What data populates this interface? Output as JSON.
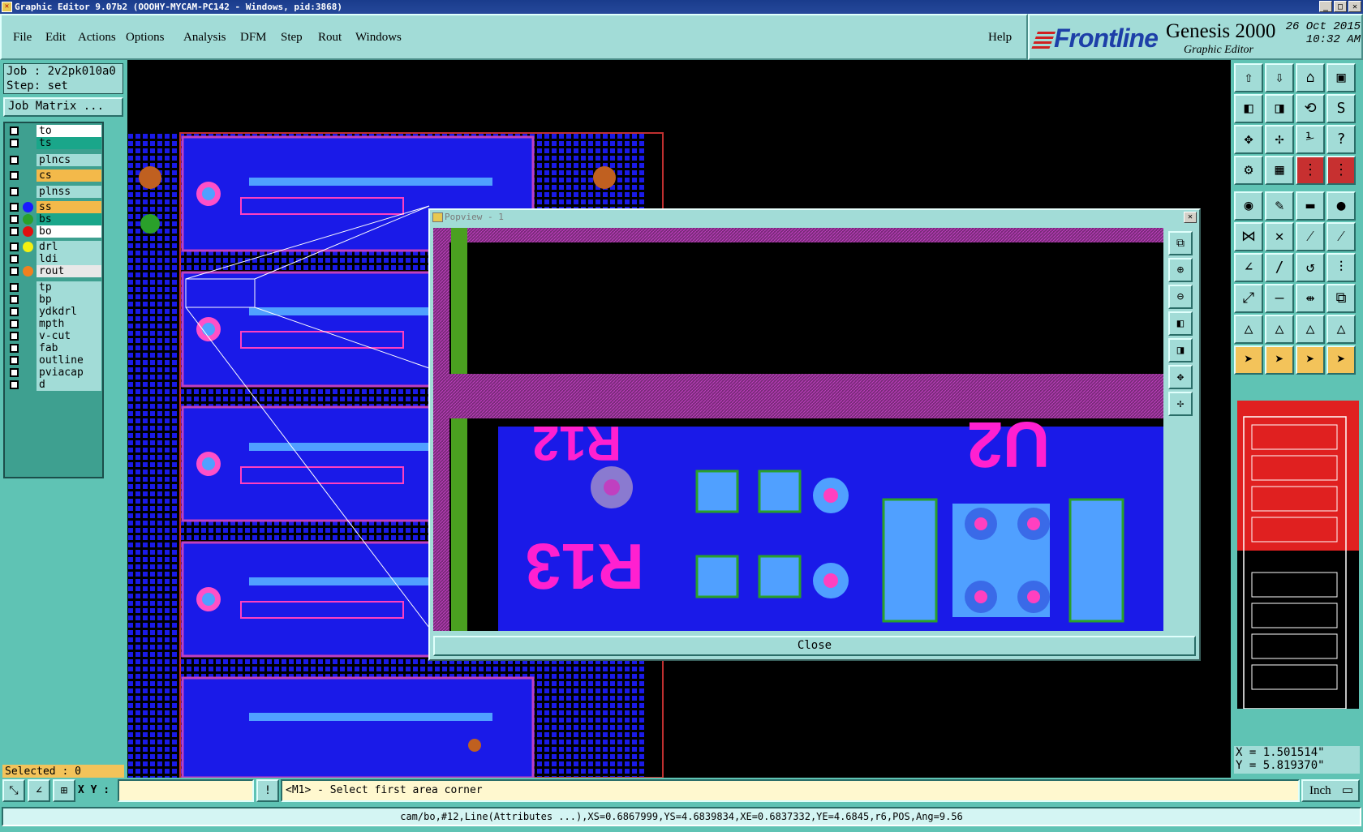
{
  "window": {
    "title": "Graphic Editor 9.07b2 (OOOHY-MYCAM-PC142 - Windows, pid:3868)"
  },
  "menu": [
    "File",
    "Edit",
    "Actions",
    "Options",
    "Analysis",
    "DFM",
    "Step",
    "Rout",
    "Windows"
  ],
  "help": "Help",
  "brand": {
    "logo": "Frontline",
    "product": "Genesis 2000",
    "subtitle": "Graphic Editor",
    "date": "26 Oct 2015",
    "time": "10:32 AM"
  },
  "job": {
    "job_line": "Job : 2v2pk010a0",
    "step_line": "Step: set",
    "matrix_button": "Job Matrix ..."
  },
  "layers": [
    {
      "name": "to",
      "bg": "#ffffff",
      "dot": ""
    },
    {
      "name": "ts",
      "bg": "#1aa68a",
      "dot": ""
    },
    {
      "name": "plncs",
      "bg": "#a2dcd7",
      "dot": ""
    },
    {
      "name": "cs",
      "bg": "#f3b94a",
      "dot": ""
    },
    {
      "name": "plnss",
      "bg": "#a2dcd7",
      "dot": ""
    },
    {
      "name": "ss",
      "bg": "#f3b94a",
      "dot": "#1a1aff"
    },
    {
      "name": "bs",
      "bg": "#1aa68a",
      "dot": "#2aa02a"
    },
    {
      "name": "bo",
      "bg": "#ffffff",
      "dot": "#e01010"
    },
    {
      "name": "drl",
      "bg": "#a2dcd7",
      "dot": "#f5f010"
    },
    {
      "name": "ldi",
      "bg": "#a2dcd7",
      "dot": ""
    },
    {
      "name": "rout",
      "bg": "#e8e8e8",
      "dot": "#f08020"
    },
    {
      "name": "tp",
      "bg": "#a2dcd7",
      "dot": ""
    },
    {
      "name": "bp",
      "bg": "#a2dcd7",
      "dot": ""
    },
    {
      "name": "ydkdrl",
      "bg": "#a2dcd7",
      "dot": ""
    },
    {
      "name": "mpth",
      "bg": "#a2dcd7",
      "dot": ""
    },
    {
      "name": "v-cut",
      "bg": "#a2dcd7",
      "dot": ""
    },
    {
      "name": "fab",
      "bg": "#a2dcd7",
      "dot": ""
    },
    {
      "name": "outline",
      "bg": "#a2dcd7",
      "dot": ""
    },
    {
      "name": "pviacap",
      "bg": "#a2dcd7",
      "dot": ""
    },
    {
      "name": "d",
      "bg": "#a2dcd7",
      "dot": ""
    }
  ],
  "selected": "Selected : 0",
  "popview": {
    "title": "Popview - 1",
    "close": "Close",
    "labels": [
      "R12",
      "U2",
      "R13"
    ]
  },
  "coords": {
    "x": "X = 1.501514\"",
    "y": "Y = 5.819370\""
  },
  "xy_label": "X Y :",
  "xy_value": "",
  "prompt": "<M1> - Select first area corner",
  "units": "Inch",
  "status": "cam/bo,#12,Line(Attributes ...),XS=0.6867999,YS=4.6839834,XE=0.6837332,YE=4.6845,r6,POS,Ang=9.56",
  "colors": {
    "accent": "#a2dcd7",
    "panel": "#5fc3b4",
    "pcb_blue": "#1a1ae8",
    "silk": "#ff20d0"
  }
}
